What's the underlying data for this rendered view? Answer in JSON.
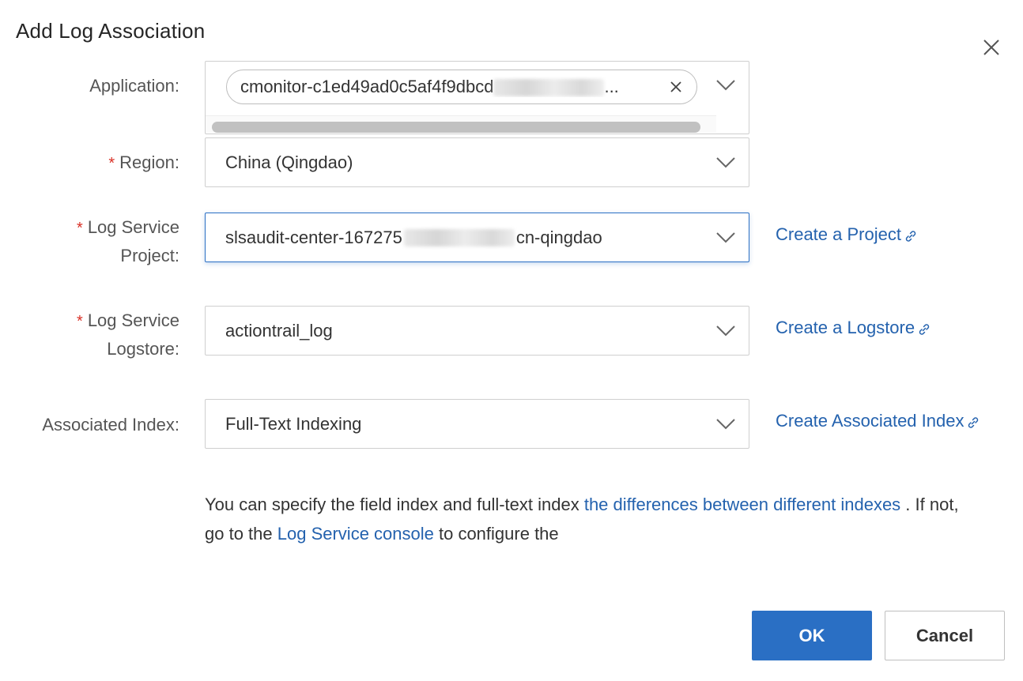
{
  "dialog": {
    "title": "Add Log Association"
  },
  "form": {
    "application": {
      "label": "Application:",
      "tag_prefix": "cmonitor-c1ed49ad0c5af4f9dbcd",
      "tag_suffix": "..."
    },
    "region": {
      "required": "*",
      "label": "Region:",
      "value": "China (Qingdao)"
    },
    "project": {
      "required": "*",
      "label_line1": "Log Service",
      "label_line2": "Project:",
      "value_prefix": "slsaudit-center-167275",
      "value_suffix": "cn-qingdao",
      "link": "Create a Project"
    },
    "logstore": {
      "required": "*",
      "label_line1": "Log Service",
      "label_line2": "Logstore:",
      "value": "actiontrail_log",
      "link": "Create a Logstore"
    },
    "index": {
      "label": "Associated Index:",
      "value": "Full-Text Indexing",
      "link": "Create Associated Index"
    }
  },
  "help": {
    "text1": "You can specify the field index and full-text index ",
    "link1": "the differences between different indexes",
    "text2": " . If not, go to the ",
    "link2": "Log Service console",
    "text3": " to configure the"
  },
  "buttons": {
    "ok": "OK",
    "cancel": "Cancel"
  },
  "colors": {
    "primary": "#2a6fc4",
    "link": "#2462ae",
    "required": "#d93026"
  },
  "icons": [
    "close-icon",
    "chevron-down-icon",
    "external-link-icon"
  ]
}
